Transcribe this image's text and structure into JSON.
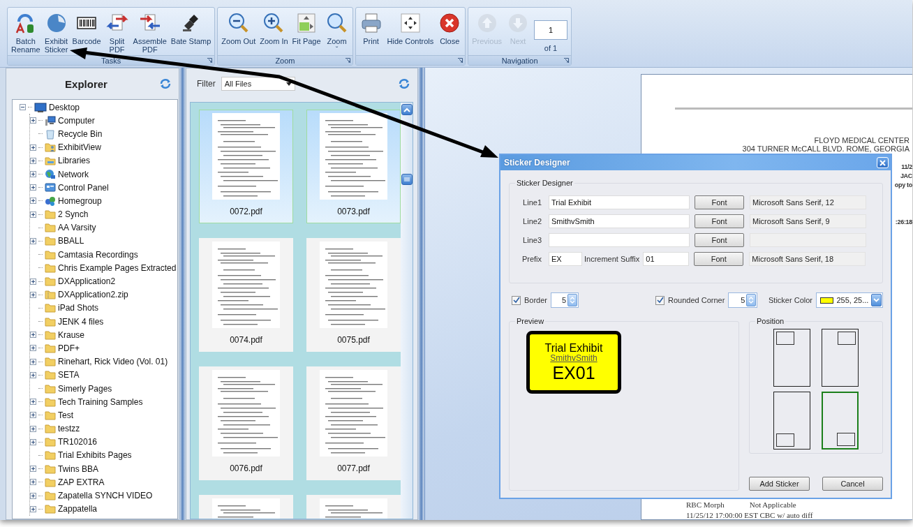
{
  "ribbon": {
    "groups": [
      {
        "title": "Tasks",
        "buttons": [
          {
            "kind": "rename",
            "lines": [
              "Batch",
              "Rename"
            ],
            "disabled": false
          },
          {
            "kind": "sticker",
            "lines": [
              "Exhibit",
              "Sticker"
            ],
            "disabled": false
          },
          {
            "kind": "barcode",
            "lines": [
              "Barcode"
            ],
            "disabled": false
          },
          {
            "kind": "split",
            "lines": [
              "Split",
              "PDF"
            ],
            "disabled": false
          },
          {
            "kind": "assemble",
            "lines": [
              "Assemble",
              "PDF"
            ],
            "disabled": false
          },
          {
            "kind": "stamp",
            "lines": [
              "Bate Stamp"
            ],
            "disabled": false
          }
        ]
      },
      {
        "title": "Zoom",
        "buttons": [
          {
            "kind": "zoom-out",
            "lines": [
              "Zoom Out"
            ],
            "disabled": false
          },
          {
            "kind": "zoom-in",
            "lines": [
              "Zoom In"
            ],
            "disabled": false
          },
          {
            "kind": "fit",
            "lines": [
              "Fit Page"
            ],
            "disabled": false
          },
          {
            "kind": "zoom",
            "lines": [
              "Zoom",
              "ˇ"
            ],
            "disabled": false
          }
        ]
      },
      {
        "buttons": [
          {
            "kind": "print",
            "lines": [
              "Print"
            ],
            "disabled": false
          },
          {
            "kind": "hide",
            "lines": [
              "Hide Controls"
            ],
            "disabled": false
          },
          {
            "kind": "close",
            "lines": [
              "Close"
            ],
            "disabled": false
          }
        ]
      },
      {
        "title": "Navigation",
        "buttons": [
          {
            "kind": "up",
            "lines": [
              "Previous"
            ],
            "disabled": true
          },
          {
            "kind": "down",
            "lines": [
              "Next"
            ],
            "disabled": true
          },
          {
            "kind": "page",
            "value": "1",
            "lines": [
              "of 1"
            ]
          }
        ]
      }
    ]
  },
  "explorer": {
    "title": "Explorer",
    "tree": {
      "label": "Desktop",
      "kind": "desktop",
      "expandable": true,
      "expanded": true,
      "children": [
        {
          "label": "Computer",
          "kind": "computer",
          "expandable": true
        },
        {
          "label": "Recycle Bin",
          "kind": "recycle",
          "expandable": false
        },
        {
          "label": "ExhibitView",
          "kind": "userfolder",
          "expandable": true
        },
        {
          "label": "Libraries",
          "kind": "libraries",
          "expandable": true
        },
        {
          "label": "Network",
          "kind": "network",
          "expandable": true
        },
        {
          "label": "Control Panel",
          "kind": "control",
          "expandable": true
        },
        {
          "label": "Homegroup",
          "kind": "homegroup",
          "expandable": true
        },
        {
          "label": "2 Synch",
          "kind": "folder",
          "expandable": true
        },
        {
          "label": "AA Varsity",
          "kind": "folder",
          "expandable": false
        },
        {
          "label": "BBALL",
          "kind": "folder",
          "expandable": true
        },
        {
          "label": "Camtasia Recordings",
          "kind": "folder",
          "expandable": false
        },
        {
          "label": "Chris Example Pages Extracted",
          "kind": "folder",
          "expandable": false
        },
        {
          "label": "DXApplication2",
          "kind": "folder",
          "expandable": true
        },
        {
          "label": "DXApplication2.zip",
          "kind": "zip",
          "expandable": true
        },
        {
          "label": "iPad Shots",
          "kind": "folder",
          "expandable": false
        },
        {
          "label": "JENK 4 files",
          "kind": "folder",
          "expandable": false
        },
        {
          "label": "Krause",
          "kind": "folder",
          "expandable": true
        },
        {
          "label": "PDF+",
          "kind": "folder",
          "expandable": true
        },
        {
          "label": "Rinehart, Rick Video (Vol. 01)",
          "kind": "folder",
          "expandable": true
        },
        {
          "label": "SETA",
          "kind": "folder",
          "expandable": true
        },
        {
          "label": "Simerly Pages",
          "kind": "folder",
          "expandable": false
        },
        {
          "label": "Tech Training Samples",
          "kind": "folder",
          "expandable": true
        },
        {
          "label": "Test",
          "kind": "folder",
          "expandable": true
        },
        {
          "label": "testzz",
          "kind": "folder",
          "expandable": true
        },
        {
          "label": "TR102016",
          "kind": "folder",
          "expandable": true
        },
        {
          "label": "Trial Exhibits Pages",
          "kind": "folder",
          "expandable": false
        },
        {
          "label": "Twins BBA",
          "kind": "folder",
          "expandable": true
        },
        {
          "label": "ZAP EXTRA",
          "kind": "folder",
          "expandable": true
        },
        {
          "label": "Zapatella SYNCH VIDEO",
          "kind": "folder",
          "expandable": true
        },
        {
          "label": "Zappatella",
          "kind": "folder",
          "expandable": true
        }
      ]
    }
  },
  "files": {
    "filter_label": "Filter",
    "filter_value": "All Files",
    "thumbnails": [
      {
        "name": "0072.pdf",
        "selected": true
      },
      {
        "name": "0073.pdf",
        "selected": true
      },
      {
        "name": "0074.pdf",
        "selected": false
      },
      {
        "name": "0075.pdf",
        "selected": false
      },
      {
        "name": "0076.pdf",
        "selected": false
      },
      {
        "name": "0077.pdf",
        "selected": false
      },
      {
        "selected": false
      },
      {
        "selected": false
      }
    ]
  },
  "document": {
    "org": "FLOYD MEDICAL CENTER",
    "address": "304 TURNER McCALL BLVD.  ROME, GEORGIA",
    "side_fragments": [
      "11/2",
      "JAC",
      "opy to",
      ":26:18"
    ],
    "bottom_lines": [
      [
        "RBC Morph",
        "Not Applicable"
      ],
      [
        "11/25/12 17:00:00 EST  CBC w/ auto diff"
      ]
    ]
  },
  "dialog": {
    "title": "Sticker Designer",
    "group": "Sticker Designer",
    "lines": [
      {
        "label": "Line1",
        "value": "Trial Exhibit",
        "button": "Font",
        "font": "Microsoft Sans Serif, 12"
      },
      {
        "label": "Line2",
        "value": "SmithvSmith",
        "button": "Font",
        "font": "Microsoft Sans Serif, 9"
      },
      {
        "label": "Line3",
        "button": "Font"
      }
    ],
    "prefix": {
      "label": "Prefix",
      "value": "EX",
      "suffix_label": "Increment Suffix",
      "suffix_value": "01",
      "button": "Font",
      "font": "Microsoft Sans Serif, 18"
    },
    "border": {
      "label": "Border",
      "checked": true,
      "value": "5"
    },
    "rounded": {
      "label": "Rounded Corner",
      "checked": true,
      "value": "5"
    },
    "sticker_color": {
      "label": "Sticker Color",
      "color": "#ffff00",
      "value": "255, 25..."
    },
    "preview": {
      "title": "Preview",
      "line1": "Trial Exhibit",
      "line2": "SmithvSmith",
      "line3": "EX01"
    },
    "position": {
      "title": "Position",
      "options": [
        {
          "kind": "top-left",
          "selected": false
        },
        {
          "kind": "bottom-left",
          "selected": false
        },
        {
          "kind": "top-right",
          "selected": false
        },
        {
          "kind": "bottom-right",
          "selected": true
        }
      ]
    },
    "buttons": [
      "Add Sticker",
      "Cancel"
    ]
  }
}
